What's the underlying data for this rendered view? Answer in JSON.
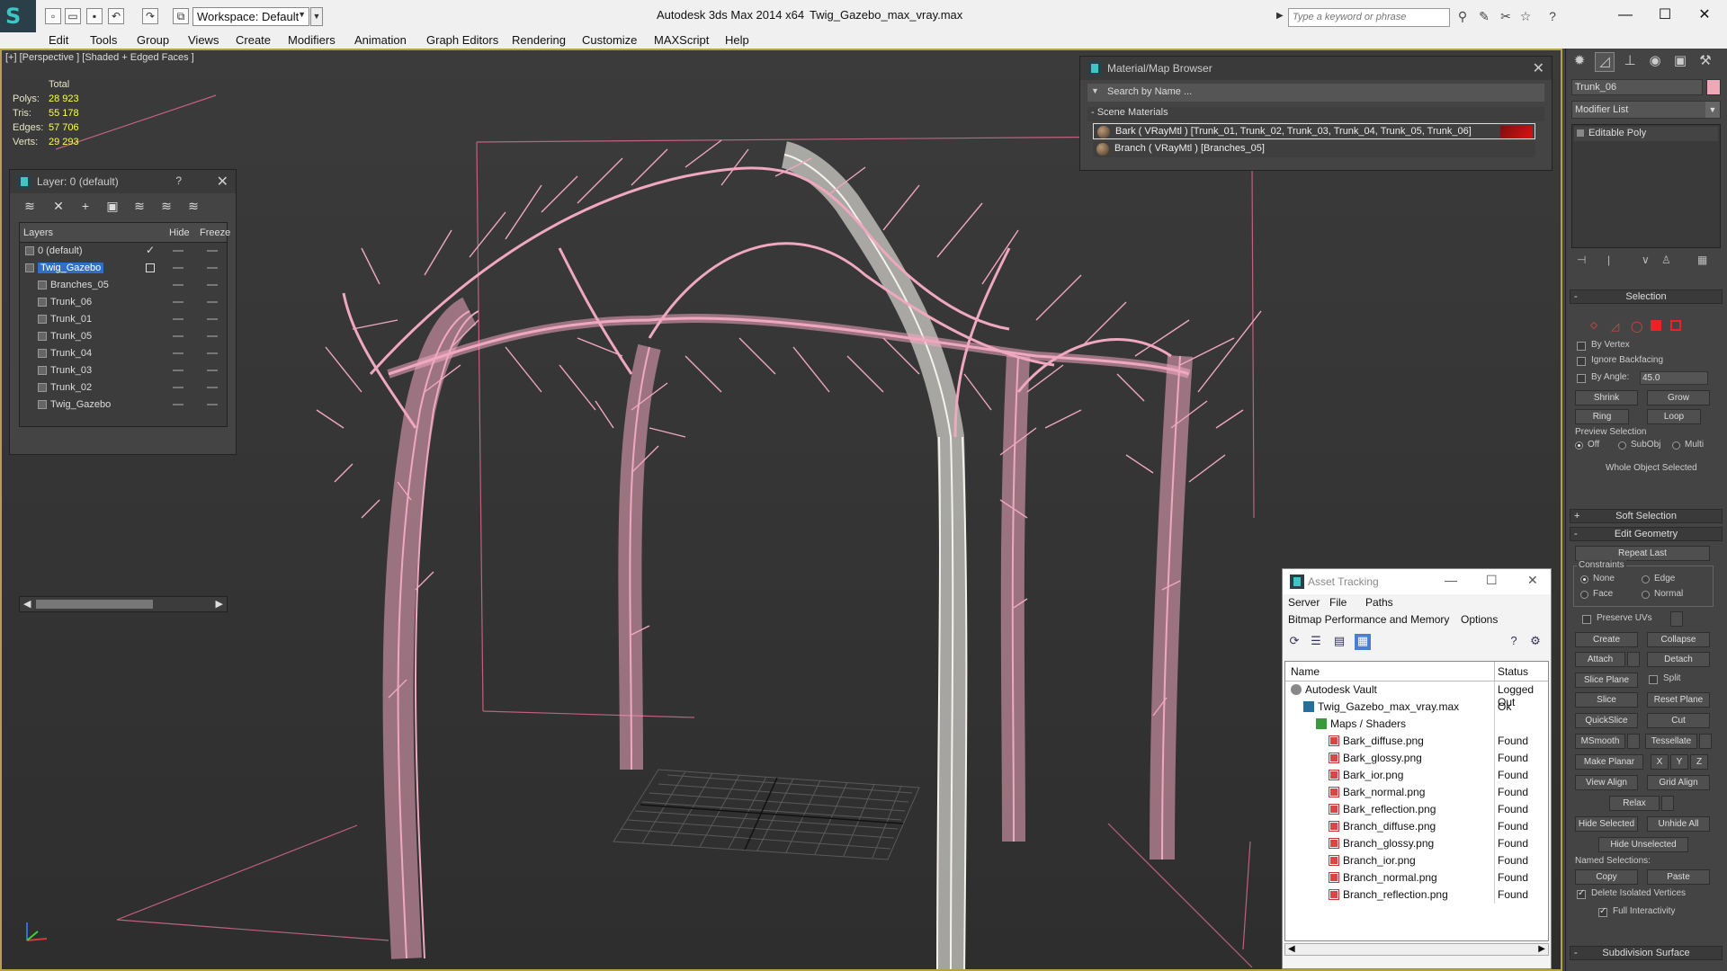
{
  "titlebar": {
    "app_title": "Autodesk 3ds Max  2014 x64",
    "file_title": "Twig_Gazebo_max_vray.max",
    "workspace_value": "Workspace: Default",
    "search_placeholder": "Type a keyword or phrase",
    "help_label": "?",
    "minimize": "—",
    "maximize": "☐",
    "close": "✕"
  },
  "menubar": {
    "items": [
      "Edit",
      "Tools",
      "Group",
      "Views",
      "Create",
      "Modifiers",
      "Animation",
      "Graph Editors",
      "Rendering",
      "Customize",
      "MAXScript",
      "Help"
    ]
  },
  "viewport": {
    "label": "[+] [Perspective ] [Shaded + Edged Faces ]",
    "stats": {
      "total_label": "Total",
      "rows": [
        {
          "label": "Polys:",
          "value": "28 923"
        },
        {
          "label": "Tris:",
          "value": "55 178"
        },
        {
          "label": "Edges:",
          "value": "57 706"
        },
        {
          "label": "Verts:",
          "value": "29 293"
        }
      ]
    },
    "object_color": "#f0a8c0",
    "selected_color": "#ffffff",
    "border_color": "#b8a04a"
  },
  "layer_panel": {
    "title": "Layer: 0 (default)",
    "help": "?",
    "close": "✕",
    "columns": {
      "layers": "Layers",
      "hide": "Hide",
      "freeze": "Freeze"
    },
    "rows": [
      {
        "name": "0 (default)",
        "indent": 0,
        "current": true
      },
      {
        "name": "Twig_Gazebo",
        "indent": 0,
        "selected": true
      },
      {
        "name": "Branches_05",
        "indent": 1
      },
      {
        "name": "Trunk_06",
        "indent": 1
      },
      {
        "name": "Trunk_01",
        "indent": 1
      },
      {
        "name": "Trunk_05",
        "indent": 1
      },
      {
        "name": "Trunk_04",
        "indent": 1
      },
      {
        "name": "Trunk_03",
        "indent": 1
      },
      {
        "name": "Trunk_02",
        "indent": 1
      },
      {
        "name": "Twig_Gazebo",
        "indent": 1
      }
    ]
  },
  "material_browser": {
    "title": "Material/Map Browser",
    "close": "✕",
    "search_placeholder": "Search by Name ...",
    "group_label": "- Scene Materials",
    "materials": [
      "Bark  ( VRayMtl )  [Trunk_01, Trunk_02, Trunk_03, Trunk_04, Trunk_05, Trunk_06]",
      "Branch  ( VRayMtl )  [Branches_05]"
    ]
  },
  "asset_tracking": {
    "title": "Asset Tracking",
    "menu1": [
      "Server",
      "File",
      "Paths"
    ],
    "menu2": [
      "Bitmap Performance and Memory",
      "Options"
    ],
    "columns": {
      "name": "Name",
      "status": "Status"
    },
    "rows": [
      {
        "name": "Autodesk Vault",
        "status": "Logged Out",
        "indent": 1,
        "icon": "vault"
      },
      {
        "name": "Twig_Gazebo_max_vray.max",
        "status": "Ok",
        "indent": 2,
        "icon": "max"
      },
      {
        "name": "Maps / Shaders",
        "status": "",
        "indent": 3,
        "icon": "folder"
      },
      {
        "name": "Bark_diffuse.png",
        "status": "Found",
        "indent": 4,
        "icon": "png"
      },
      {
        "name": "Bark_glossy.png",
        "status": "Found",
        "indent": 4,
        "icon": "png"
      },
      {
        "name": "Bark_ior.png",
        "status": "Found",
        "indent": 4,
        "icon": "png"
      },
      {
        "name": "Bark_normal.png",
        "status": "Found",
        "indent": 4,
        "icon": "png"
      },
      {
        "name": "Bark_reflection.png",
        "status": "Found",
        "indent": 4,
        "icon": "png"
      },
      {
        "name": "Branch_diffuse.png",
        "status": "Found",
        "indent": 4,
        "icon": "png"
      },
      {
        "name": "Branch_glossy.png",
        "status": "Found",
        "indent": 4,
        "icon": "png"
      },
      {
        "name": "Branch_ior.png",
        "status": "Found",
        "indent": 4,
        "icon": "png"
      },
      {
        "name": "Branch_normal.png",
        "status": "Found",
        "indent": 4,
        "icon": "png"
      },
      {
        "name": "Branch_reflection.png",
        "status": "Found",
        "indent": 4,
        "icon": "png"
      }
    ]
  },
  "command_panel": {
    "object_name": "Trunk_06",
    "object_color": "#f0a8b8",
    "modifier_list": "Modifier List",
    "stack_item": "Editable Poly",
    "selection": {
      "title": "Selection",
      "by_vertex": "By Vertex",
      "ignore_backfacing": "Ignore Backfacing",
      "by_angle": "By Angle:",
      "angle_value": "45.0",
      "shrink": "Shrink",
      "grow": "Grow",
      "ring": "Ring",
      "loop": "Loop",
      "preview_selection": "Preview Selection",
      "off": "Off",
      "subobj": "SubObj",
      "multi": "Multi",
      "status": "Whole Object Selected"
    },
    "soft_selection": "Soft Selection",
    "edit_geometry": {
      "title": "Edit Geometry",
      "repeat_last": "Repeat Last",
      "constraints": "Constraints",
      "none": "None",
      "edge": "Edge",
      "face": "Face",
      "normal": "Normal",
      "preserve_uvs": "Preserve UVs",
      "create": "Create",
      "collapse": "Collapse",
      "attach": "Attach",
      "detach": "Detach",
      "slice_plane": "Slice Plane",
      "split": "Split",
      "slice": "Slice",
      "reset_plane": "Reset Plane",
      "quickslice": "QuickSlice",
      "cut": "Cut",
      "msmooth": "MSmooth",
      "tessellate": "Tessellate",
      "make_planar": "Make Planar",
      "x": "X",
      "y": "Y",
      "z": "Z",
      "view_align": "View Align",
      "grid_align": "Grid Align",
      "relax": "Relax",
      "hide_selected": "Hide Selected",
      "unhide_all": "Unhide All",
      "hide_unselected": "Hide Unselected",
      "named_selections": "Named Selections:",
      "copy": "Copy",
      "paste": "Paste",
      "delete_isolated": "Delete Isolated Vertices",
      "full_interactivity": "Full Interactivity"
    },
    "subdivision_surface": "Subdivision Surface"
  }
}
